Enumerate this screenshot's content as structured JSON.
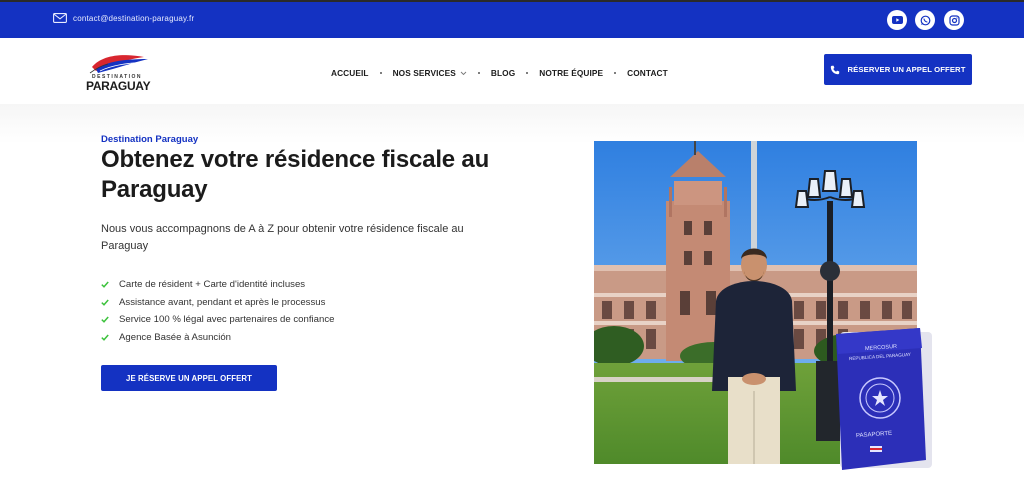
{
  "topbar": {
    "email": "contact@destination-paraguay.fr",
    "social": [
      "youtube-icon",
      "whatsapp-icon",
      "instagram-icon"
    ]
  },
  "header": {
    "logo_sub": "DESTINATION",
    "logo_main": "PARAGUAY",
    "nav": [
      {
        "label": "ACCUEIL"
      },
      {
        "label": "NOS SERVICES"
      },
      {
        "label": "BLOG"
      },
      {
        "label": "NOTRE ÉQUIPE"
      },
      {
        "label": "CONTACT"
      }
    ],
    "cta": "RÉSERVER UN APPEL OFFERT"
  },
  "hero": {
    "eyebrow": "Destination Paraguay",
    "title": "Obtenez votre résidence fiscale au Paraguay",
    "lead": "Nous vous accompagnons de A à Z pour obtenir votre résidence fiscale au Paraguay",
    "features": [
      "Carte de résident + Carte d'identité incluses",
      "Assistance avant, pendant et après le processus",
      "Service 100 % légal avec partenaires de confiance",
      "Agence Basée à Asunción"
    ],
    "cta": "JE RÉSERVE UN APPEL OFFERT"
  },
  "passport": {
    "top1": "MERCOSUR",
    "top2": "REPUBLICA DEL PARAGUAY",
    "bottom": "PASAPORTE"
  },
  "colors": {
    "brand": "#1432c2",
    "check": "#3cc23c"
  }
}
